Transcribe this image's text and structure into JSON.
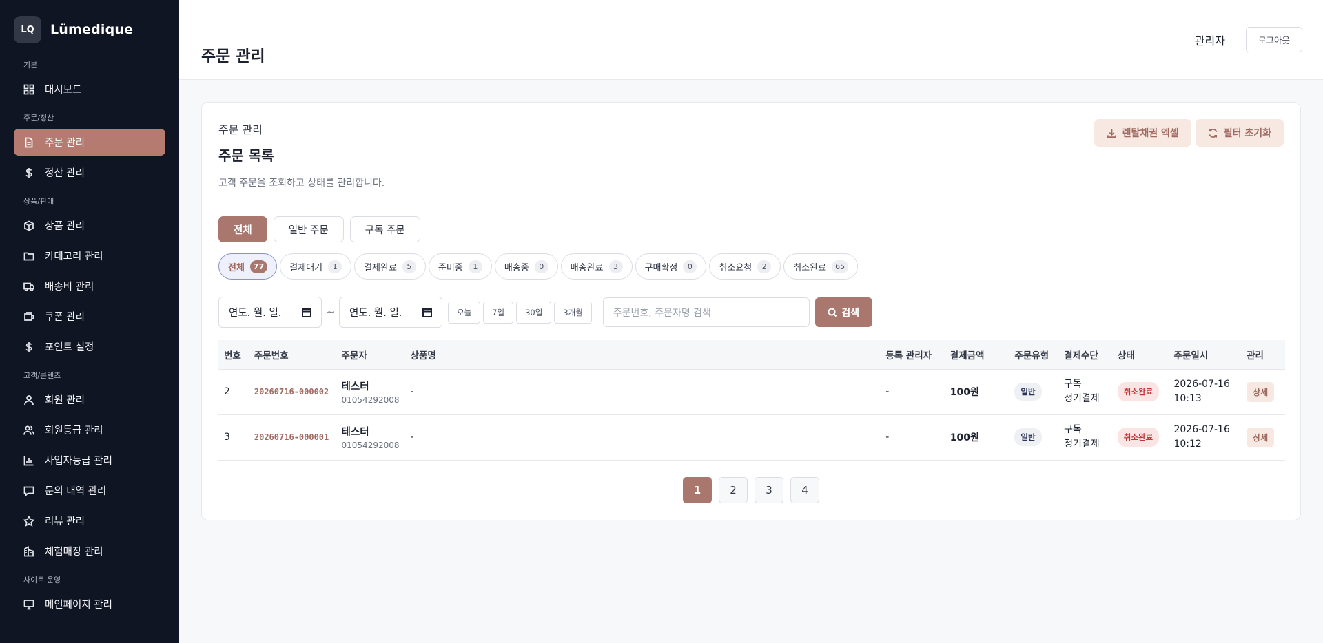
{
  "brand": {
    "logo": "LQ",
    "name": "Lümedique"
  },
  "sidebar": {
    "sections": [
      {
        "title": "기본",
        "items": [
          {
            "label": "대시보드",
            "icon": "grid-icon"
          }
        ]
      },
      {
        "title": "주문/정산",
        "items": [
          {
            "label": "주문 관리",
            "icon": "document-icon",
            "active": true
          },
          {
            "label": "정산 관리",
            "icon": "dollar-icon"
          }
        ]
      },
      {
        "title": "상품/판매",
        "items": [
          {
            "label": "상품 관리",
            "icon": "box-icon"
          },
          {
            "label": "카테고리 관리",
            "icon": "folder-icon"
          },
          {
            "label": "배송비 관리",
            "icon": "truck-icon"
          },
          {
            "label": "쿠폰 관리",
            "icon": "coupon-icon"
          },
          {
            "label": "포인트 설정",
            "icon": "dollar-icon"
          }
        ]
      },
      {
        "title": "고객/콘텐츠",
        "items": [
          {
            "label": "회원 관리",
            "icon": "user-icon"
          },
          {
            "label": "회원등급 관리",
            "icon": "users-icon"
          },
          {
            "label": "사업자등급 관리",
            "icon": "chart-icon"
          },
          {
            "label": "문의 내역 관리",
            "icon": "message-icon"
          },
          {
            "label": "리뷰 관리",
            "icon": "star-icon"
          },
          {
            "label": "체험매장 관리",
            "icon": "building-icon"
          }
        ]
      },
      {
        "title": "사이트 운영",
        "items": [
          {
            "label": "메인페이지 관리",
            "icon": "monitor-icon"
          }
        ]
      }
    ]
  },
  "header": {
    "title": "주문 관리",
    "admin": "관리자",
    "logout": "로그아웃"
  },
  "card": {
    "breadcrumb": "주문 관리",
    "title": "주문 목록",
    "description": "고객 주문을 조회하고 상태를 관리합니다.",
    "excel_button": "렌탈채권 엑셀",
    "reset_button": "필터 초기화"
  },
  "order_types": [
    "전체",
    "일반 주문",
    "구독 주문"
  ],
  "status_chips": [
    {
      "label": "전체",
      "count": "77"
    },
    {
      "label": "결제대기",
      "count": "1"
    },
    {
      "label": "결제완료",
      "count": "5"
    },
    {
      "label": "준비중",
      "count": "1"
    },
    {
      "label": "배송중",
      "count": "0"
    },
    {
      "label": "배송완료",
      "count": "3"
    },
    {
      "label": "구매확정",
      "count": "0"
    },
    {
      "label": "취소요청",
      "count": "2"
    },
    {
      "label": "취소완료",
      "count": "65"
    }
  ],
  "filters": {
    "date_placeholder": "연도. 월. 일.",
    "tilde": "~",
    "quick": [
      "오늘",
      "7일",
      "30일",
      "3개월"
    ],
    "search_placeholder": "주문번호, 주문자명 검색",
    "search_button": "검색"
  },
  "table": {
    "columns": [
      "번호",
      "주문번호",
      "주문자",
      "상품명",
      "등록 관리자",
      "결제금액",
      "주문유형",
      "결제수단",
      "상태",
      "주문일시",
      "관리"
    ],
    "rows": [
      {
        "no": "2",
        "order_no": "20260716-000002",
        "customer": "테스터",
        "phone": "01054292008",
        "product": "-",
        "admin": "-",
        "amount": "100원",
        "type": "일반",
        "pay_1": "구독",
        "pay_2": "정기결제",
        "status": "취소완료",
        "date": "2026-07-16",
        "time": "10:13",
        "action": "상세"
      },
      {
        "no": "3",
        "order_no": "20260716-000001",
        "customer": "테스터",
        "phone": "01054292008",
        "product": "-",
        "admin": "-",
        "amount": "100원",
        "type": "일반",
        "pay_1": "구독",
        "pay_2": "정기결제",
        "status": "취소완료",
        "date": "2026-07-16",
        "time": "10:12",
        "action": "상세"
      }
    ]
  },
  "pagination": {
    "pages": [
      "1",
      "2",
      "3",
      "4"
    ],
    "current": "1"
  }
}
